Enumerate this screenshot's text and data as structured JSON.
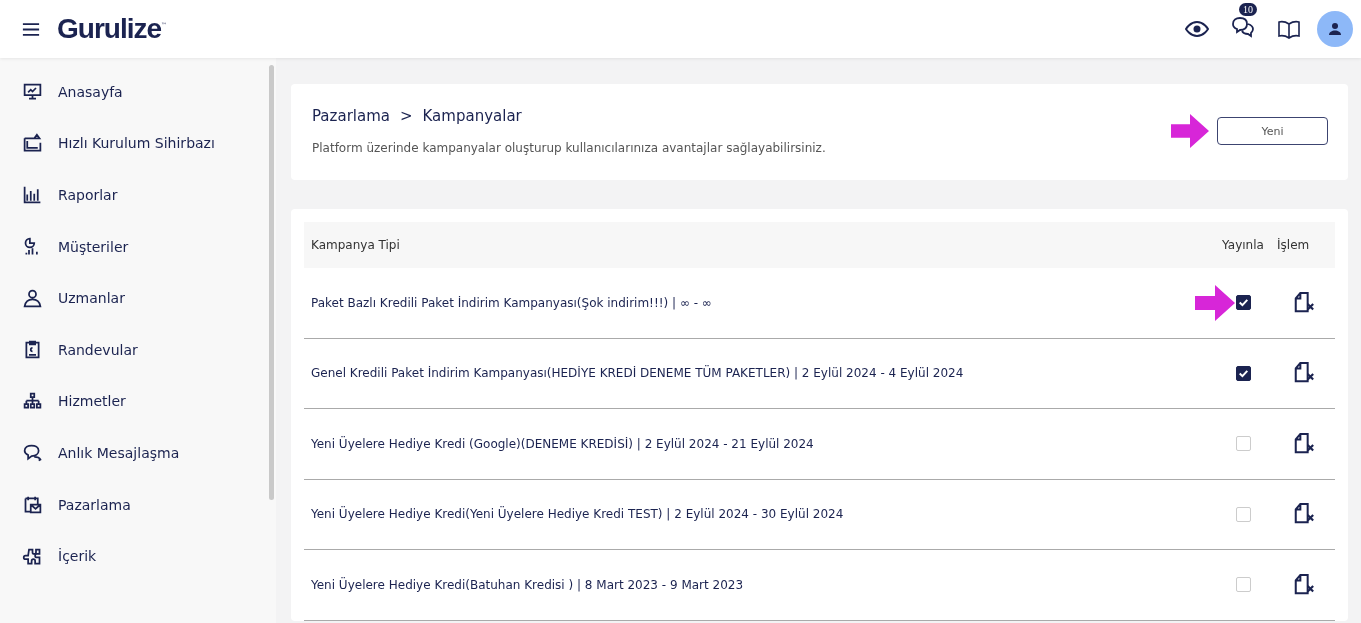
{
  "header": {
    "logo": "Gurulize",
    "logo_mark": "™",
    "messages_badge": "10"
  },
  "sidebar": {
    "items": [
      {
        "label": "Anasayfa"
      },
      {
        "label": "Hızlı Kurulum Sihirbazı"
      },
      {
        "label": "Raporlar"
      },
      {
        "label": "Müşteriler"
      },
      {
        "label": "Uzmanlar"
      },
      {
        "label": "Randevular"
      },
      {
        "label": "Hizmetler"
      },
      {
        "label": "Anlık Mesajlaşma"
      },
      {
        "label": "Pazarlama"
      },
      {
        "label": "İçerik"
      }
    ]
  },
  "page": {
    "breadcrumb": [
      "Pazarlama",
      "Kampanyalar"
    ],
    "separator": ">",
    "description": "Platform üzerinde kampanyalar oluşturup kullanıcılarınıza avantajlar sağlayabilirsiniz.",
    "new_button": "Yeni"
  },
  "table": {
    "columns": [
      "Kampanya Tipi",
      "Yayınla",
      "İşlem"
    ],
    "rows": [
      {
        "name": "Paket Bazlı Kredili Paket İndirim Kampanyası(Şok indirim!!!) | ∞ - ∞",
        "checked": true
      },
      {
        "name": "Genel Kredili Paket İndirim Kampanyası(HEDİYE KREDİ DENEME TÜM PAKETLER) | 2 Eylül 2024 - 4 Eylül 2024",
        "checked": true
      },
      {
        "name": "Yeni Üyelere Hediye Kredi (Google)(DENEME KREDİSİ) | 2 Eylül 2024 - 21 Eylül 2024",
        "checked": false
      },
      {
        "name": "Yeni Üyelere Hediye Kredi(Yeni Üyelere Hediye Kredi TEST) | 2 Eylül 2024 - 30 Eylül 2024",
        "checked": false
      },
      {
        "name": "Yeni Üyelere Hediye Kredi(Batuhan Kredisi ) | 8 Mart 2023 - 9 Mart 2023",
        "checked": false
      }
    ]
  }
}
